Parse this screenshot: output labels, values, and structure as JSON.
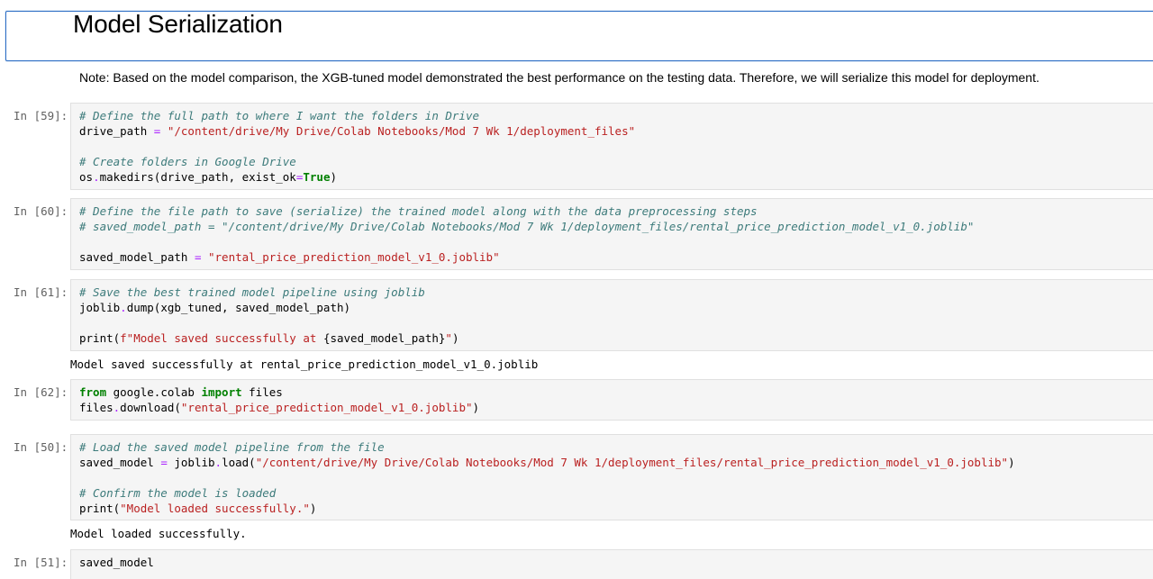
{
  "markdown": {
    "title": "Model Serialization",
    "note": "Note: Based on the model comparison, the XGB-tuned model demonstrated the best performance on the testing data. Therefore, we will serialize this model for deployment."
  },
  "colors": {
    "comment": "#3d7b7b",
    "string": "#ba2121",
    "keyword": "#008000",
    "operator": "#aa22ff",
    "selected_border": "#2f6fc5",
    "prompt": "#616161",
    "cell_bg": "#f5f5f5"
  },
  "cells": [
    {
      "prompt": "In [59]:",
      "lines": [
        [
          {
            "t": "comment",
            "v": "# Define the full path to where I want the folders in Drive"
          }
        ],
        [
          {
            "t": "name",
            "v": "drive_path "
          },
          {
            "t": "operator",
            "v": "="
          },
          {
            "t": "name",
            "v": " "
          },
          {
            "t": "string",
            "v": "\"/content/drive/My Drive/Colab Notebooks/Mod 7 Wk 1/deployment_files\""
          }
        ],
        [],
        [
          {
            "t": "comment",
            "v": "# Create folders in Google Drive"
          }
        ],
        [
          {
            "t": "name",
            "v": "os"
          },
          {
            "t": "operator",
            "v": "."
          },
          {
            "t": "name",
            "v": "makedirs(drive_path, exist_ok"
          },
          {
            "t": "operator",
            "v": "="
          },
          {
            "t": "keyword",
            "v": "True"
          },
          {
            "t": "name",
            "v": ")"
          }
        ]
      ],
      "output": null
    },
    {
      "prompt": "In [60]:",
      "lines": [
        [
          {
            "t": "comment",
            "v": "# Define the file path to save (serialize) the trained model along with the data preprocessing steps"
          }
        ],
        [
          {
            "t": "comment",
            "v": "# saved_model_path = \"/content/drive/My Drive/Colab Notebooks/Mod 7 Wk 1/deployment_files/rental_price_prediction_model_v1_0.joblib\""
          }
        ],
        [],
        [
          {
            "t": "name",
            "v": "saved_model_path "
          },
          {
            "t": "operator",
            "v": "="
          },
          {
            "t": "name",
            "v": " "
          },
          {
            "t": "string",
            "v": "\"rental_price_prediction_model_v1_0.joblib\""
          }
        ]
      ],
      "output": null
    },
    {
      "prompt": "In [61]:",
      "lines": [
        [
          {
            "t": "comment",
            "v": "# Save the best trained model pipeline using joblib"
          }
        ],
        [
          {
            "t": "name",
            "v": "joblib"
          },
          {
            "t": "operator",
            "v": "."
          },
          {
            "t": "name",
            "v": "dump(xgb_tuned, saved_model_path)"
          }
        ],
        [],
        [
          {
            "t": "name",
            "v": "print("
          },
          {
            "t": "string",
            "v": "f\"Model saved successfully at "
          },
          {
            "t": "name",
            "v": "{saved_model_path}"
          },
          {
            "t": "string",
            "v": "\""
          },
          {
            "t": "name",
            "v": ")"
          }
        ]
      ],
      "output": "Model saved successfully at rental_price_prediction_model_v1_0.joblib"
    },
    {
      "prompt": "In [62]:",
      "lines": [
        [
          {
            "t": "keyword",
            "v": "from"
          },
          {
            "t": "name",
            "v": " google.colab "
          },
          {
            "t": "keyword",
            "v": "import"
          },
          {
            "t": "name",
            "v": " files"
          }
        ],
        [
          {
            "t": "name",
            "v": "files"
          },
          {
            "t": "operator",
            "v": "."
          },
          {
            "t": "name",
            "v": "download("
          },
          {
            "t": "string",
            "v": "\"rental_price_prediction_model_v1_0.joblib\""
          },
          {
            "t": "name",
            "v": ")"
          }
        ]
      ],
      "output": null
    },
    {
      "prompt": "In [50]:",
      "lines": [
        [
          {
            "t": "comment",
            "v": "# Load the saved model pipeline from the file"
          }
        ],
        [
          {
            "t": "name",
            "v": "saved_model "
          },
          {
            "t": "operator",
            "v": "="
          },
          {
            "t": "name",
            "v": " joblib"
          },
          {
            "t": "operator",
            "v": "."
          },
          {
            "t": "name",
            "v": "load("
          },
          {
            "t": "string",
            "v": "\"/content/drive/My Drive/Colab Notebooks/Mod 7 Wk 1/deployment_files/rental_price_prediction_model_v1_0.joblib\""
          },
          {
            "t": "name",
            "v": ")"
          }
        ],
        [],
        [
          {
            "t": "comment",
            "v": "# Confirm the model is loaded"
          }
        ],
        [
          {
            "t": "name",
            "v": "print("
          },
          {
            "t": "string",
            "v": "\"Model loaded successfully.\""
          },
          {
            "t": "name",
            "v": ")"
          }
        ]
      ],
      "output": "Model loaded successfully."
    },
    {
      "prompt": "In [51]:",
      "lines": [
        [
          {
            "t": "name",
            "v": "saved_model"
          }
        ]
      ],
      "output": null
    }
  ]
}
